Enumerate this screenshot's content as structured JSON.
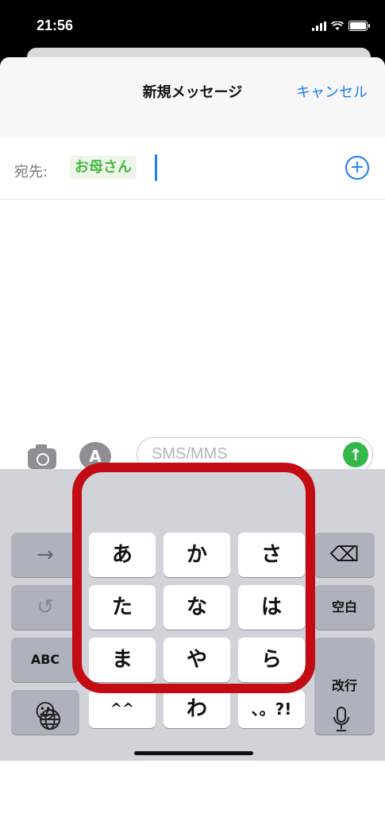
{
  "status": {
    "time": "21:56"
  },
  "nav": {
    "title": "新規メッセージ",
    "cancel": "キャンセル"
  },
  "recipient": {
    "label": "宛先:",
    "name": "お母さん"
  },
  "compose": {
    "placeholder": "SMS/MMS"
  },
  "keyboard": {
    "left": {
      "arrow": "→",
      "undo": "↺",
      "abc": "ABC",
      "emoji": "☺"
    },
    "grid": [
      [
        "あ",
        "か",
        "さ"
      ],
      [
        "た",
        "な",
        "は"
      ],
      [
        "ま",
        "や",
        "ら"
      ],
      [
        "^^",
        "わ",
        "、。?!"
      ]
    ],
    "right": {
      "delete": "⌫",
      "space": "空白",
      "return": "改行"
    },
    "bottom": {
      "globe": "globe-icon",
      "mic": "mic-icon"
    }
  },
  "colors": {
    "accent": "#1a7cf3",
    "recipient": "#42b93e",
    "send": "#34b84a",
    "highlight": "#c30b14"
  }
}
